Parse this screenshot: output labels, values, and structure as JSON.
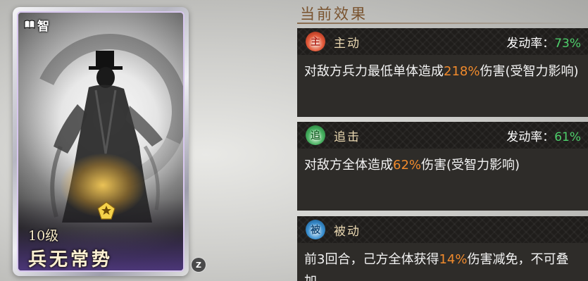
{
  "card": {
    "type_label": "智",
    "level": "10级",
    "name": "兵无常势"
  },
  "hotkey": "Z",
  "panel": {
    "title": "当前效果",
    "effects": [
      {
        "icon": "主",
        "icon_color": "#e35a3a",
        "name": "主动",
        "rate_label": "发动率：",
        "rate_value": "73%",
        "desc_pre": "对敌方兵力最低单体造成",
        "desc_hl": "218%",
        "desc_post": "伤害(受智力影响)"
      },
      {
        "icon": "追",
        "icon_color": "#46b060",
        "name": "追击",
        "rate_label": "发动率：",
        "rate_value": "61%",
        "desc_pre": "对敌方全体造成",
        "desc_hl": "62%",
        "desc_post": "伤害(受智力影响)"
      },
      {
        "icon": "被",
        "icon_color": "#3a8fcf",
        "name": "被动",
        "desc_pre": "前3回合，己方全体获得",
        "desc_hl": "14%",
        "desc_post": "伤害减免，不可叠加"
      }
    ]
  }
}
